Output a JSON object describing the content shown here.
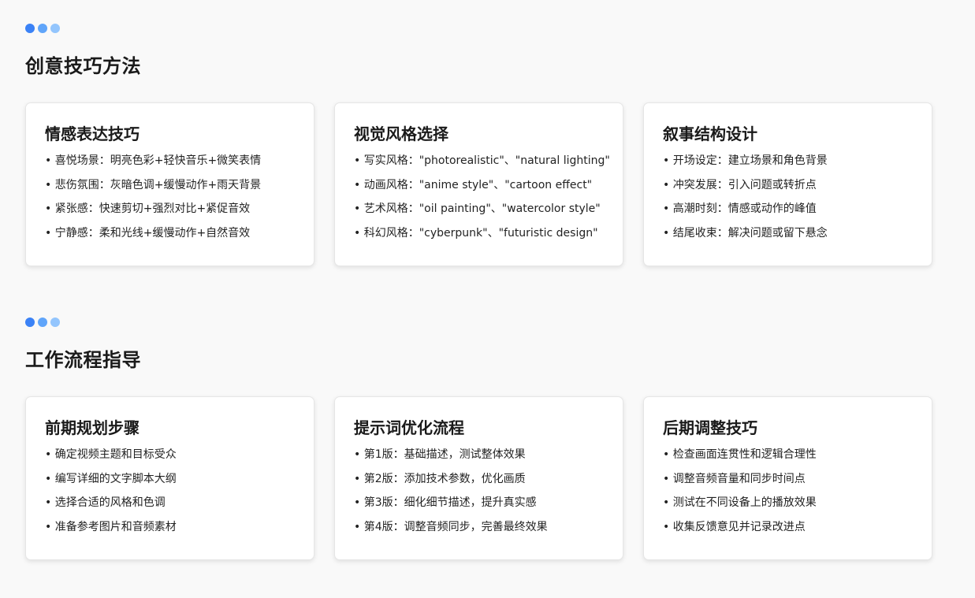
{
  "colors": {
    "dot1": "#3b82f6",
    "dot2": "#60a5fa",
    "dot3": "#93c5fd",
    "background": "#f9f9f9",
    "card": "#ffffff"
  },
  "sections": [
    {
      "title": "创意技巧方法",
      "cards": [
        {
          "title": "情感表达技巧",
          "items": [
            "喜悦场景：明亮色彩+轻快音乐+微笑表情",
            "悲伤氛围：灰暗色调+缓慢动作+雨天背景",
            "紧张感：快速剪切+强烈对比+紧促音效",
            "宁静感：柔和光线+缓慢动作+自然音效"
          ]
        },
        {
          "title": "视觉风格选择",
          "items": [
            "写实风格：\"photorealistic\"、\"natural lighting\"",
            "动画风格：\"anime style\"、\"cartoon effect\"",
            "艺术风格：\"oil painting\"、\"watercolor style\"",
            "科幻风格：\"cyberpunk\"、\"futuristic design\""
          ]
        },
        {
          "title": "叙事结构设计",
          "items": [
            "开场设定：建立场景和角色背景",
            "冲突发展：引入问题或转折点",
            "高潮时刻：情感或动作的峰值",
            "结尾收束：解决问题或留下悬念"
          ]
        }
      ]
    },
    {
      "title": "工作流程指导",
      "cards": [
        {
          "title": "前期规划步骤",
          "items": [
            "确定视频主题和目标受众",
            "编写详细的文字脚本大纲",
            "选择合适的风格和色调",
            "准备参考图片和音频素材"
          ]
        },
        {
          "title": "提示词优化流程",
          "items": [
            "第1版：基础描述，测试整体效果",
            "第2版：添加技术参数，优化画质",
            "第3版：细化细节描述，提升真实感",
            "第4版：调整音频同步，完善最终效果"
          ]
        },
        {
          "title": "后期调整技巧",
          "items": [
            "检查画面连贯性和逻辑合理性",
            "调整音频音量和同步时间点",
            "测试在不同设备上的播放效果",
            "收集反馈意见并记录改进点"
          ]
        }
      ]
    }
  ]
}
